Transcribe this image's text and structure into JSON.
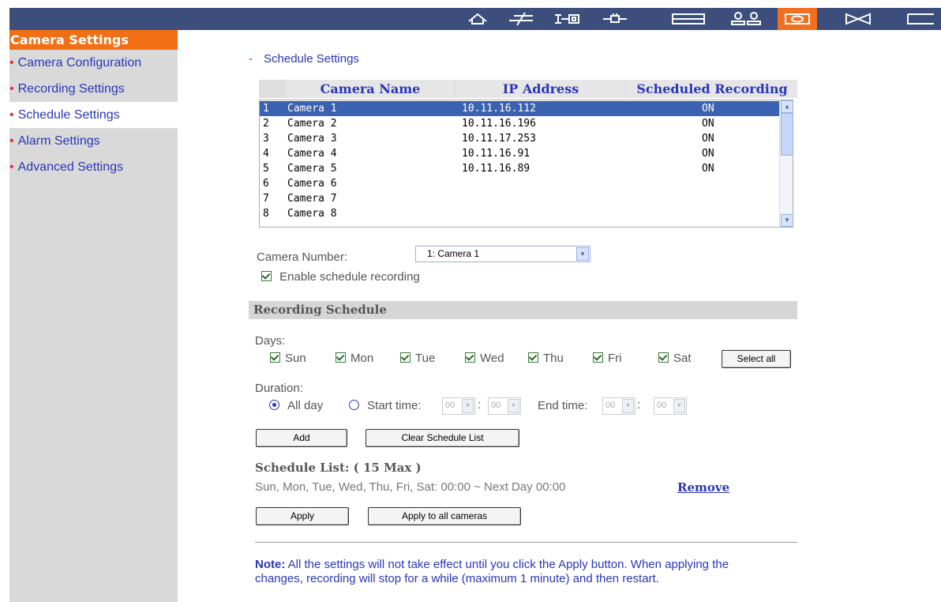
{
  "sidebar": {
    "header": "Camera Settings",
    "items": [
      {
        "label": "Camera Configuration",
        "active": false
      },
      {
        "label": "Recording Settings",
        "active": false
      },
      {
        "label": "Schedule Settings",
        "active": true
      },
      {
        "label": "Alarm Settings",
        "active": false
      },
      {
        "label": "Advanced Settings",
        "active": false
      }
    ]
  },
  "topbar": {
    "icons": [
      "home-icon",
      "network-icon",
      "device-icon",
      "connection-icon",
      "panel-icon",
      "users-icon",
      "camera-icon",
      "tools-icon",
      "more-icon"
    ],
    "active_color": "#f07020",
    "bar_color": "#3b4e7c"
  },
  "main": {
    "section_title": "Schedule Settings",
    "camera_table": {
      "headers": [
        "Camera Name",
        "IP Address",
        "Scheduled Recording"
      ],
      "rows": [
        {
          "num": "1",
          "name": "Camera 1",
          "ip": "10.11.16.112",
          "sched": "ON"
        },
        {
          "num": "2",
          "name": "Camera 2",
          "ip": "10.11.16.196",
          "sched": "ON"
        },
        {
          "num": "3",
          "name": "Camera 3",
          "ip": "10.11.17.253",
          "sched": "ON"
        },
        {
          "num": "4",
          "name": "Camera 4",
          "ip": "10.11.16.91",
          "sched": "ON"
        },
        {
          "num": "5",
          "name": "Camera 5",
          "ip": "10.11.16.89",
          "sched": "ON"
        },
        {
          "num": "6",
          "name": "Camera 6",
          "ip": "",
          "sched": ""
        },
        {
          "num": "7",
          "name": "Camera 7",
          "ip": "",
          "sched": ""
        },
        {
          "num": "8",
          "name": "Camera 8",
          "ip": "",
          "sched": ""
        }
      ]
    },
    "camera_number_label": "Camera Number:",
    "camera_number_value": "1: Camera 1",
    "enable_label": "Enable schedule recording",
    "recording_schedule_title": "Recording Schedule",
    "days_label": "Days:",
    "days": [
      "Sun",
      "Mon",
      "Tue",
      "Wed",
      "Thu",
      "Fri",
      "Sat"
    ],
    "select_all_label": "Select all",
    "duration_label": "Duration:",
    "all_day_label": "All day",
    "start_time_label": "Start time:",
    "end_time_label": "End time:",
    "time_value": "00",
    "time_sep": ":",
    "add_label": "Add",
    "clear_label": "Clear Schedule List",
    "schedule_list_title": "Schedule List: ( 15 Max )",
    "schedule_entry": "Sun, Mon, Tue, Wed, Thu, Fri, Sat: 00:00 ~ Next Day 00:00",
    "remove_label": "Remove",
    "apply_label": "Apply",
    "apply_all_label": "Apply to all cameras",
    "note_label": "Note:",
    "note_text": " All the settings will not take effect until you click the Apply button. When applying the changes, recording will stop for a while (maximum 1 minute) and then restart."
  }
}
